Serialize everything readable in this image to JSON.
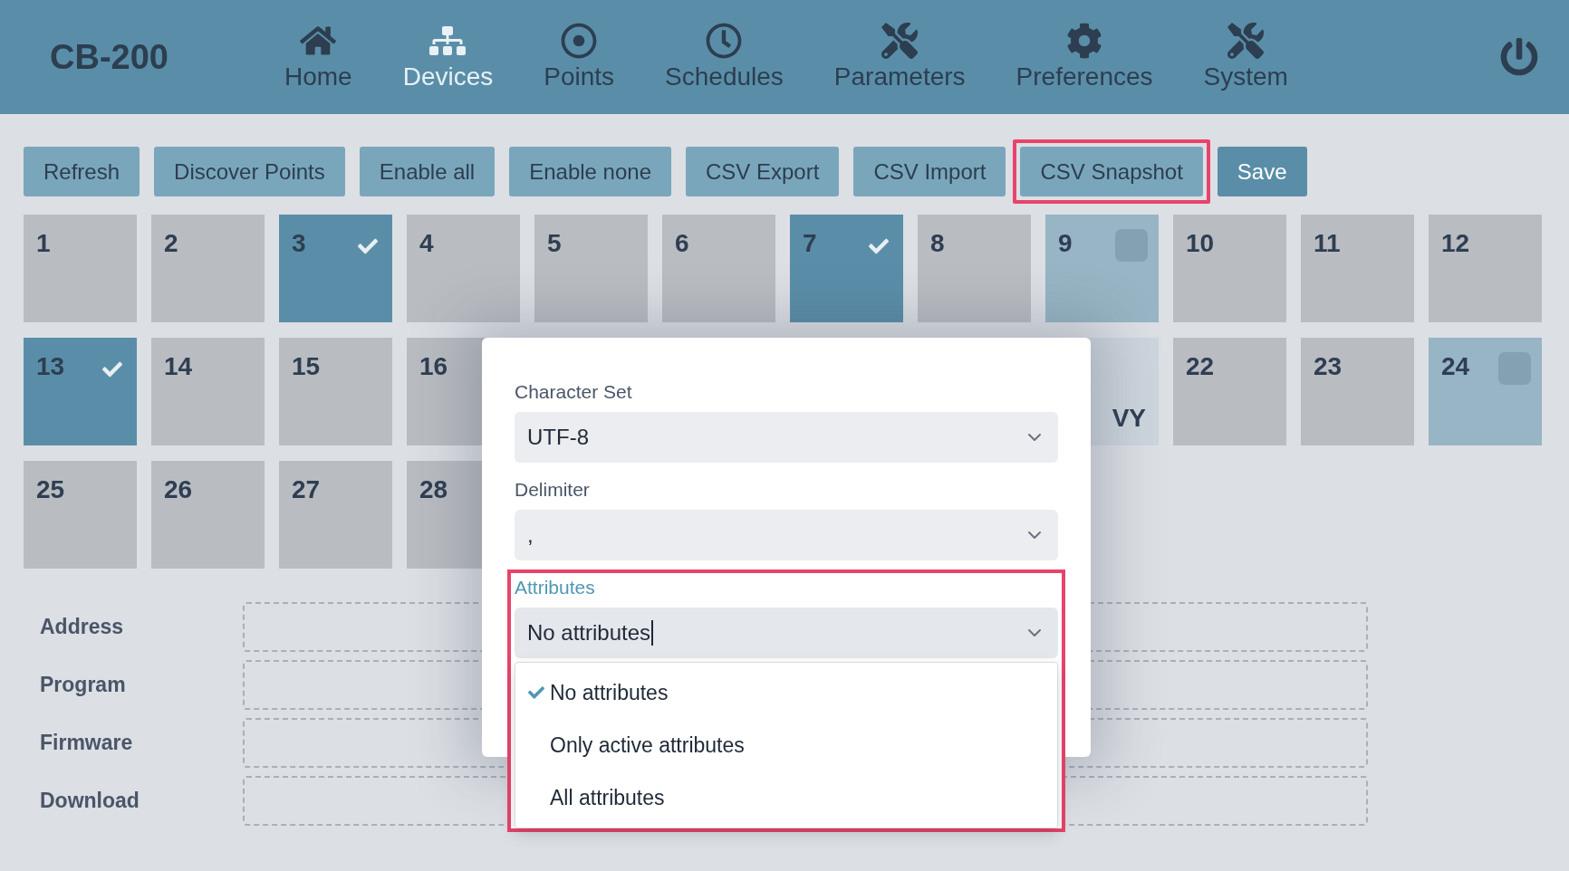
{
  "header": {
    "logo": "CB-200",
    "nav": [
      {
        "label": "Home",
        "kind": "home",
        "selected": false
      },
      {
        "label": "Devices",
        "kind": "devices",
        "selected": true
      },
      {
        "label": "Points",
        "kind": "points",
        "selected": false
      },
      {
        "label": "Schedules",
        "kind": "schedules",
        "selected": false
      },
      {
        "label": "Parameters",
        "kind": "tools",
        "selected": false
      },
      {
        "label": "Preferences",
        "kind": "gear",
        "selected": false
      },
      {
        "label": "System",
        "kind": "tools",
        "selected": false
      }
    ]
  },
  "toolbar": [
    {
      "label": "Refresh",
      "kind": "normal",
      "highlighted": false
    },
    {
      "label": "Discover Points",
      "kind": "normal",
      "highlighted": false
    },
    {
      "label": "Enable all",
      "kind": "normal",
      "highlighted": false
    },
    {
      "label": "Enable none",
      "kind": "normal",
      "highlighted": false
    },
    {
      "label": "CSV Export",
      "kind": "normal",
      "highlighted": false
    },
    {
      "label": "CSV Import",
      "kind": "normal",
      "highlighted": false
    },
    {
      "label": "CSV Snapshot",
      "kind": "normal",
      "highlighted": true
    },
    {
      "label": "Save",
      "kind": "primary",
      "highlighted": false
    }
  ],
  "tile_rows": [
    {
      "left": [
        {
          "number": "1",
          "kind": "off"
        },
        {
          "number": "2",
          "kind": "off"
        },
        {
          "number": "3",
          "kind": "on"
        },
        {
          "number": "4",
          "kind": "off"
        },
        {
          "number": "5",
          "kind": "off"
        },
        {
          "number": "6",
          "kind": "off"
        },
        {
          "number": "7",
          "kind": "on"
        },
        {
          "number": "8",
          "kind": "off"
        },
        {
          "number": "9",
          "kind": "pending"
        },
        {
          "number": "10",
          "kind": "off"
        },
        {
          "number": "11",
          "kind": "off"
        },
        {
          "number": "12",
          "kind": "off"
        }
      ]
    },
    {
      "left": [
        {
          "number": "13",
          "kind": "on"
        },
        {
          "number": "14",
          "kind": "off"
        },
        {
          "number": "15",
          "kind": "off"
        },
        {
          "number": "16",
          "kind": "off"
        }
      ],
      "right": [
        {
          "caption": "VY",
          "kind": "faded"
        },
        {
          "number": "22",
          "kind": "off"
        },
        {
          "number": "23",
          "kind": "off"
        },
        {
          "number": "24",
          "kind": "pending"
        }
      ]
    },
    {
      "left": [
        {
          "number": "25",
          "kind": "off"
        },
        {
          "number": "26",
          "kind": "off"
        },
        {
          "number": "27",
          "kind": "off"
        },
        {
          "number": "28",
          "kind": "off"
        }
      ]
    }
  ],
  "form": [
    {
      "label": "Address"
    },
    {
      "label": "Program"
    },
    {
      "label": "Firmware"
    },
    {
      "label": "Download"
    }
  ],
  "dialog": {
    "fields": [
      {
        "label": "Character Set",
        "value": "UTF-8",
        "highlighted": false,
        "focused": false
      },
      {
        "label": "Delimiter",
        "value": ",",
        "highlighted": false,
        "focused": false
      },
      {
        "label": "Attributes",
        "value": "No attributes",
        "highlighted": true,
        "focused": true,
        "options": [
          {
            "label": "No attributes",
            "selected": true
          },
          {
            "label": "Only active attributes",
            "selected": false
          },
          {
            "label": "All attributes",
            "selected": false
          }
        ]
      }
    ]
  }
}
